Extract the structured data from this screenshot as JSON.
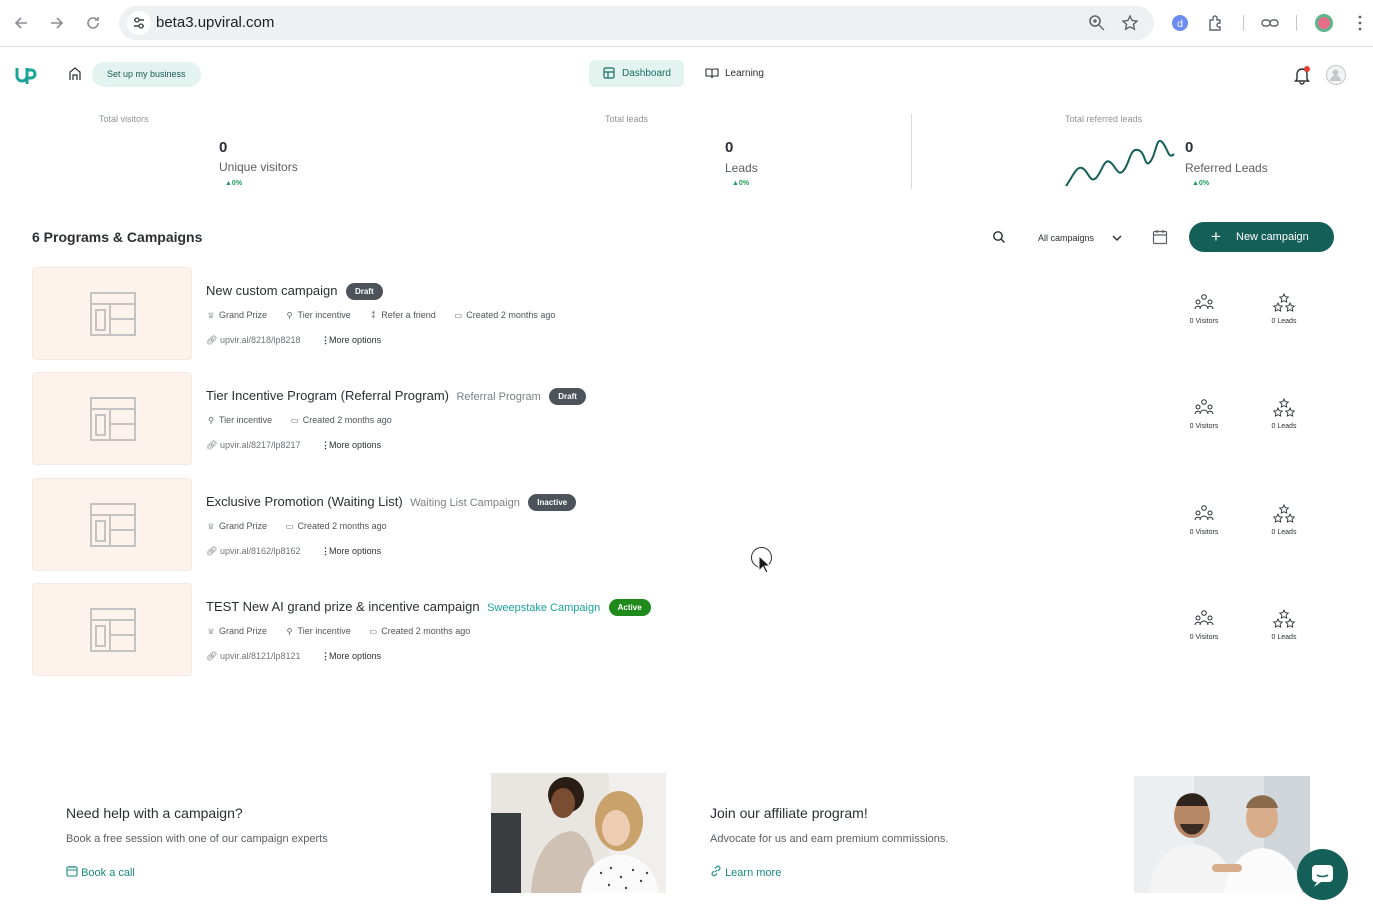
{
  "browser": {
    "url": "beta3.upviral.com"
  },
  "header": {
    "setup_label": "Set up my business",
    "tabs": [
      {
        "label": "Dashboard",
        "active": true
      },
      {
        "label": "Learning",
        "active": false
      }
    ]
  },
  "stats": [
    {
      "label": "Total visitors",
      "value": "0",
      "sub": "Unique visitors",
      "change": "▲0%"
    },
    {
      "label": "Total leads",
      "value": "0",
      "sub": "Leads",
      "change": "▲0%"
    },
    {
      "label": "Total referred leads",
      "value": "0",
      "sub": "Referred Leads",
      "change": "▲0%"
    }
  ],
  "programs": {
    "title": "6 Programs & Campaigns",
    "filter": "All campaigns",
    "new_button": "New campaign"
  },
  "campaigns": [
    {
      "title": "New custom campaign",
      "type": "",
      "status": "Draft",
      "meta": [
        "Grand Prize",
        "Tier incentive",
        "Refer a friend",
        "Created 2 months ago"
      ],
      "link": "upvir.al/8218/lp8218",
      "more": "More options",
      "visitors": "0 Visitors",
      "leads": "0 Leads"
    },
    {
      "title": "Tier Incentive Program (Referral Program)",
      "type": "Referral Program",
      "status": "Draft",
      "meta": [
        "Tier incentive",
        "Created 2 months ago"
      ],
      "link": "upvir.al/8217/lp8217",
      "more": "More options",
      "visitors": "0 Visitors",
      "leads": "0 Leads"
    },
    {
      "title": "Exclusive Promotion (Waiting List)",
      "type": "Waiting List Campaign",
      "status": "Inactive",
      "meta": [
        "Grand Prize",
        "Created 2 months ago"
      ],
      "link": "upvir.al/8162/lp8162",
      "more": "More options",
      "visitors": "0 Visitors",
      "leads": "0 Leads"
    },
    {
      "title": "TEST New AI grand prize & incentive campaign",
      "type": "Sweepstake Campaign",
      "status": "Active",
      "meta": [
        "Grand Prize",
        "Tier incentive",
        "Created 2 months ago"
      ],
      "link": "upvir.al/8121/lp8121",
      "more": "More options",
      "visitors": "0 Visitors",
      "leads": "0 Leads"
    }
  ],
  "promos": [
    {
      "title": "Need help with a campaign?",
      "sub": "Book a free session with one of our campaign experts",
      "link": "Book a call"
    },
    {
      "title": "Join our affiliate program!",
      "sub": "Advocate for us and earn premium commissions.",
      "link": "Learn more"
    }
  ],
  "colors": {
    "brand": "#155f59",
    "accent_light": "#e2f3f0",
    "positive": "#1e9a5a",
    "active_badge": "#1f8a1b",
    "draft_badge": "#4d535a",
    "thumb_bg": "#fdf2ec"
  }
}
